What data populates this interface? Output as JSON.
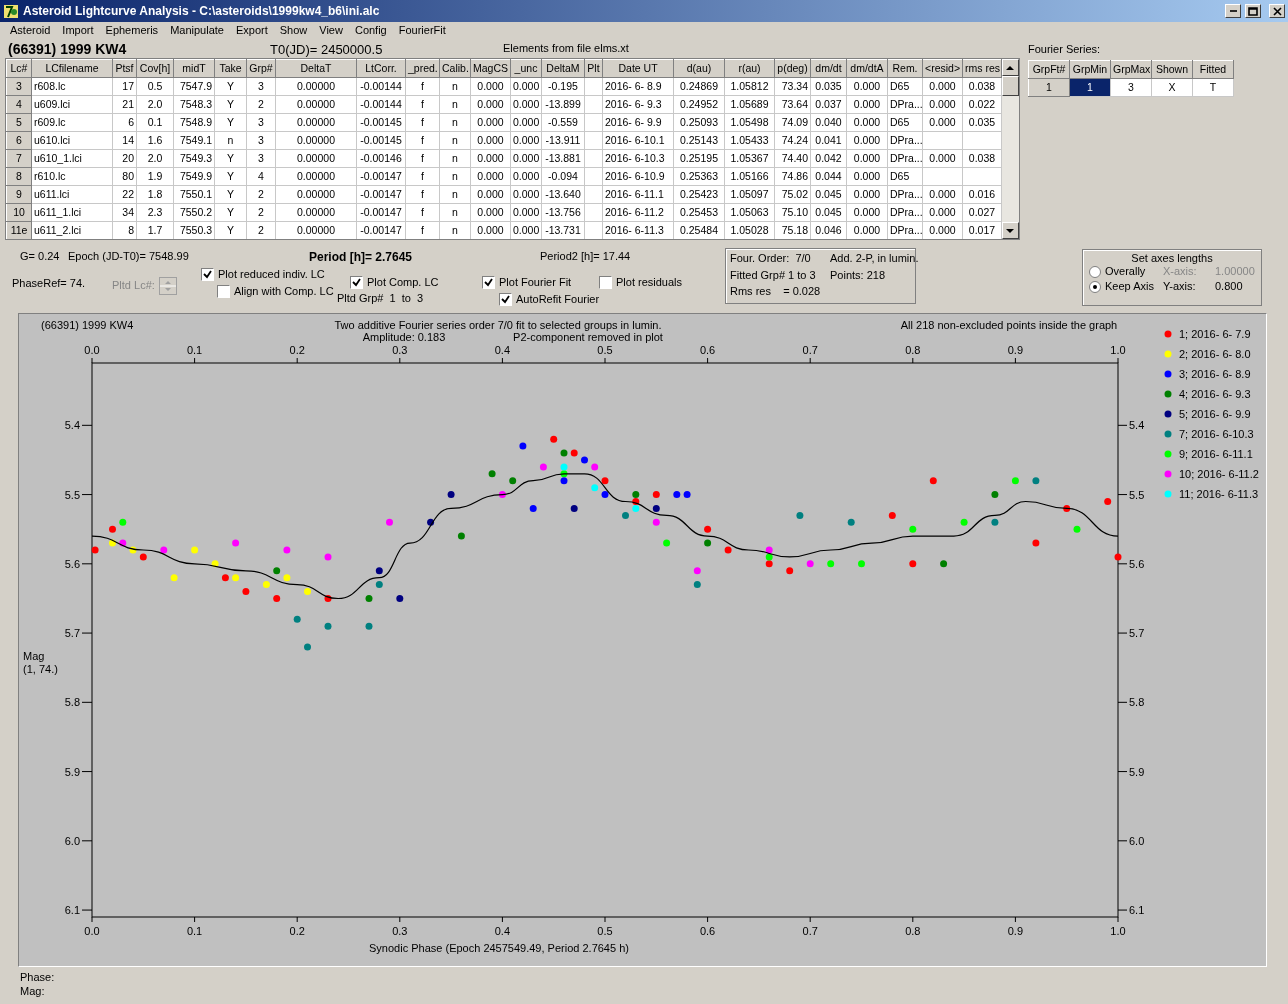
{
  "window": {
    "title": "Asteroid Lightcurve Analysis - C:\\asteroids\\1999kw4_b6\\ini.alc"
  },
  "menu": [
    "Asteroid",
    "Import",
    "Ephemeris",
    "Manipulate",
    "Export",
    "Show",
    "View",
    "Config",
    "FourierFit"
  ],
  "asteroid_name": "(66391) 1999 KW4",
  "t0": "T0(JD)= 2450000.5",
  "elements_note": "Elements from file elms.xt",
  "lc_table": {
    "columns": [
      "Lc#",
      "LCfilename",
      "Ptsf",
      "Cov[h]",
      "midT",
      "Take",
      "Grp#",
      "DeltaT",
      "LtCorr.",
      "_pred.",
      "Calib.",
      "MagCS",
      "_unc",
      "DeltaM",
      "Plt",
      "Date UT",
      "d(au)",
      "r(au)",
      "p(deg)",
      "dm/dt",
      "dm/dtA",
      "Rem.",
      "<resid>",
      "rms res"
    ],
    "rows": [
      {
        "cells": [
          "3",
          "r608.lc",
          "17",
          "0.5",
          "7547.9",
          "Y",
          "3",
          "0.00000",
          "-0.00144",
          "f",
          "n",
          "0.000",
          "0.000",
          "-0.195",
          null,
          "2016- 6- 8.9",
          "0.24869",
          "1.05812",
          "73.34",
          "0.035",
          "0.000",
          "D65",
          "0.000",
          "0.038"
        ]
      },
      {
        "cells": [
          "4",
          "u609.lci",
          "21",
          "2.0",
          "7548.3",
          "Y",
          "2",
          "0.00000",
          "-0.00144",
          "f",
          "n",
          "0.000",
          "0.000",
          "-13.899",
          null,
          "2016- 6- 9.3",
          "0.24952",
          "1.05689",
          "73.64",
          "0.037",
          "0.000",
          "DPra...",
          "0.000",
          "0.022"
        ]
      },
      {
        "cells": [
          "5",
          "r609.lc",
          "6",
          "0.1",
          "7548.9",
          "Y",
          "3",
          "0.00000",
          "-0.00145",
          "f",
          "n",
          "0.000",
          "0.000",
          "-0.559",
          null,
          "2016- 6- 9.9",
          "0.25093",
          "1.05498",
          "74.09",
          "0.040",
          "0.000",
          "D65",
          "0.000",
          "0.035"
        ]
      },
      {
        "cells": [
          "6",
          "u610.lci",
          "14",
          "1.6",
          "7549.1",
          "n",
          "3",
          "0.00000",
          "-0.00145",
          "f",
          "n",
          "0.000",
          "0.000",
          "-13.911",
          null,
          "2016- 6-10.1",
          "0.25143",
          "1.05433",
          "74.24",
          "0.041",
          "0.000",
          "DPra...",
          null,
          null
        ]
      },
      {
        "cells": [
          "7",
          "u610_1.lci",
          "20",
          "2.0",
          "7549.3",
          "Y",
          "3",
          "0.00000",
          "-0.00146",
          "f",
          "n",
          "0.000",
          "0.000",
          "-13.881",
          null,
          "2016- 6-10.3",
          "0.25195",
          "1.05367",
          "74.40",
          "0.042",
          "0.000",
          "DPra...",
          "0.000",
          "0.038"
        ]
      },
      {
        "cells": [
          "8",
          "r610.lc",
          "80",
          "1.9",
          "7549.9",
          "Y",
          "4",
          "0.00000",
          "-0.00147",
          "f",
          "n",
          "0.000",
          "0.000",
          "-0.094",
          null,
          "2016- 6-10.9",
          "0.25363",
          "1.05166",
          "74.86",
          "0.044",
          "0.000",
          "D65",
          null,
          null
        ]
      },
      {
        "cells": [
          "9",
          "u611.lci",
          "22",
          "1.8",
          "7550.1",
          "Y",
          "2",
          "0.00000",
          "-0.00147",
          "f",
          "n",
          "0.000",
          "0.000",
          "-13.640",
          null,
          "2016- 6-11.1",
          "0.25423",
          "1.05097",
          "75.02",
          "0.045",
          "0.000",
          "DPra...",
          "0.000",
          "0.016"
        ]
      },
      {
        "cells": [
          "10",
          "u611_1.lci",
          "34",
          "2.3",
          "7550.2",
          "Y",
          "2",
          "0.00000",
          "-0.00147",
          "f",
          "n",
          "0.000",
          "0.000",
          "-13.756",
          null,
          "2016- 6-11.2",
          "0.25453",
          "1.05063",
          "75.10",
          "0.045",
          "0.000",
          "DPra...",
          "0.000",
          "0.027"
        ]
      },
      {
        "cells": [
          "11e",
          "u611_2.lci",
          "8",
          "1.7",
          "7550.3",
          "Y",
          "2",
          "0.00000",
          "-0.00147",
          "f",
          "n",
          "0.000",
          "0.000",
          "-13.731",
          null,
          "2016- 6-11.3",
          "0.25484",
          "1.05028",
          "75.18",
          "0.046",
          "0.000",
          "DPra...",
          "0.000",
          "0.017"
        ]
      }
    ]
  },
  "fourier_series": {
    "label": "Fourier Series:",
    "columns": [
      "GrpFt#",
      "GrpMin",
      "GrpMax",
      "Shown",
      "Fitted"
    ],
    "rows": [
      {
        "cells": [
          {
            "text": "1",
            "selected": false
          },
          {
            "text": "1",
            "selected": true
          },
          {
            "text": "3",
            "selected": false
          },
          {
            "text": "X",
            "selected": false
          },
          {
            "text": "T",
            "selected": false
          }
        ]
      }
    ]
  },
  "params": {
    "g": "G= 0.24",
    "epoch": "Epoch (JD-T0)= 7548.99",
    "period": "Period [h]= 2.7645",
    "period2": "Period2 [h]= 17.44",
    "phase_ref": "PhaseRef= 74.",
    "pltd_lc": {
      "label": "Pltd Lc#:",
      "disabled": true
    },
    "pltd_grp": "Pltd Grp#  1  to  3"
  },
  "checkboxes": [
    {
      "label": "Plot reduced indiv. LC",
      "checked": true
    },
    {
      "label": "Align with Comp. LC",
      "checked": false
    },
    {
      "label": "Plot Comp. LC",
      "checked": true
    },
    {
      "label": "Plot Fourier Fit",
      "checked": true
    },
    {
      "label": "AutoRefit Fourier",
      "checked": true
    },
    {
      "label": "Plot residuals",
      "checked": false
    }
  ],
  "fit_info": [
    "Four. Order:  7/0",
    "Add. 2-P, in lumin.",
    "Fitted Grp# 1 to 3",
    "Points: 218",
    "Rms res    = 0.028"
  ],
  "axes_box": {
    "title": "Set axes lengths",
    "options": [
      {
        "label": "Overally",
        "selected": false
      },
      {
        "label": "Keep Axis",
        "selected": true
      }
    ],
    "x_axis": {
      "label": "X-axis:",
      "value": "1.00000",
      "disabled": true
    },
    "y_axis": {
      "label": "Y-axis:",
      "value": "0.800",
      "disabled": false
    }
  },
  "plot": {
    "object_name": "(66391) 1999 KW4",
    "title": "Two additive Fourier series order 7/0 fit to selected groups in lumin.",
    "amplitude": "Amplitude: 0.183",
    "note": "P2-component removed in plot",
    "points_note": "All 218 non-excluded points inside the graph",
    "ylabel_note": "(1, 74.)",
    "chart_data": {
      "type": "scatter",
      "xlabel": "Synodic Phase (Epoch 2457549.49, Period 2.7645 h)",
      "ylabel": "Mag",
      "xlim": [
        0,
        1
      ],
      "ylim": [
        6.11,
        5.31
      ],
      "xticks": [
        {
          "value": 0,
          "label": "0.0"
        },
        {
          "value": 0.1,
          "label": "0.1"
        },
        {
          "value": 0.2,
          "label": "0.2"
        },
        {
          "value": 0.3,
          "label": "0.3"
        },
        {
          "value": 0.4,
          "label": "0.4"
        },
        {
          "value": 0.5,
          "label": "0.5"
        },
        {
          "value": 0.6,
          "label": "0.6"
        },
        {
          "value": 0.7,
          "label": "0.7"
        },
        {
          "value": 0.8,
          "label": "0.8"
        },
        {
          "value": 0.9,
          "label": "0.9"
        },
        {
          "value": 1,
          "label": "1.0"
        }
      ],
      "yticks": [
        {
          "value": 5.4,
          "label": "5.4"
        },
        {
          "value": 5.5,
          "label": "5.5"
        },
        {
          "value": 5.6,
          "label": "5.6"
        },
        {
          "value": 5.7,
          "label": "5.7"
        },
        {
          "value": 5.8,
          "label": "5.8"
        },
        {
          "value": 5.9,
          "label": "5.9"
        },
        {
          "value": 6,
          "label": "6.0"
        },
        {
          "value": 6.1,
          "label": "6.1"
        }
      ],
      "series": [
        {
          "name": "1; 2016- 6- 7.9",
          "color": "#ff0000",
          "x": [
            0.003,
            0.02,
            0.05,
            0.13,
            0.15,
            0.18,
            0.23,
            0.45,
            0.47,
            0.5,
            0.53,
            0.55,
            0.6,
            0.62,
            0.66,
            0.68,
            0.78,
            0.8,
            0.82,
            0.92,
            0.95,
            0.99,
            1.0
          ],
          "values": [
            5.58,
            5.55,
            5.59,
            5.62,
            5.64,
            5.65,
            5.65,
            5.42,
            5.44,
            5.48,
            5.51,
            5.5,
            5.55,
            5.58,
            5.6,
            5.61,
            5.53,
            5.6,
            5.48,
            5.57,
            5.52,
            5.51,
            5.59
          ]
        },
        {
          "name": "2; 2016- 6- 8.0",
          "color": "#ffff00",
          "x": [
            0.02,
            0.04,
            0.08,
            0.1,
            0.12,
            0.14,
            0.17,
            0.19,
            0.21
          ],
          "values": [
            5.57,
            5.58,
            5.62,
            5.58,
            5.6,
            5.62,
            5.63,
            5.62,
            5.64
          ]
        },
        {
          "name": "3; 2016- 6- 8.9",
          "color": "#0000ff",
          "x": [
            0.42,
            0.43,
            0.46,
            0.48,
            0.5,
            0.57,
            0.58
          ],
          "values": [
            5.43,
            5.52,
            5.48,
            5.45,
            5.5,
            5.5,
            5.5
          ]
        },
        {
          "name": "4; 2016- 6- 9.3",
          "color": "#008000",
          "x": [
            0.18,
            0.27,
            0.36,
            0.39,
            0.41,
            0.46,
            0.53,
            0.6,
            0.83,
            0.88
          ],
          "values": [
            5.61,
            5.65,
            5.56,
            5.47,
            5.48,
            5.44,
            5.5,
            5.57,
            5.6,
            5.5
          ]
        },
        {
          "name": "5; 2016- 6- 9.9",
          "color": "#000080",
          "x": [
            0.28,
            0.3,
            0.33,
            0.35,
            0.47,
            0.55
          ],
          "values": [
            5.61,
            5.65,
            5.54,
            5.5,
            5.52,
            5.52
          ]
        },
        {
          "name": "7; 2016- 6-10.3",
          "color": "#008080",
          "x": [
            0.2,
            0.21,
            0.23,
            0.27,
            0.28,
            0.52,
            0.59,
            0.69,
            0.74,
            0.88,
            0.92
          ],
          "values": [
            5.68,
            5.72,
            5.69,
            5.69,
            5.63,
            5.53,
            5.63,
            5.53,
            5.54,
            5.54,
            5.48
          ]
        },
        {
          "name": "9; 2016- 6-11.1",
          "color": "#00ff00",
          "x": [
            0.03,
            0.46,
            0.56,
            0.66,
            0.72,
            0.75,
            0.8,
            0.85,
            0.9,
            0.96
          ],
          "values": [
            5.54,
            5.47,
            5.57,
            5.59,
            5.6,
            5.6,
            5.55,
            5.54,
            5.48,
            5.55
          ]
        },
        {
          "name": "10; 2016- 6-11.2",
          "color": "#ff00ff",
          "x": [
            0.03,
            0.07,
            0.14,
            0.19,
            0.23,
            0.29,
            0.4,
            0.44,
            0.49,
            0.55,
            0.59,
            0.66,
            0.7
          ],
          "values": [
            5.57,
            5.58,
            5.57,
            5.58,
            5.59,
            5.54,
            5.5,
            5.46,
            5.46,
            5.54,
            5.61,
            5.58,
            5.6
          ]
        },
        {
          "name": "11; 2016- 6-11.3",
          "color": "#00ffff",
          "x": [
            0.46,
            0.49,
            0.53
          ],
          "values": [
            5.46,
            5.49,
            5.52
          ]
        },
        {
          "type": "line",
          "color": "#000000",
          "x": [
            0,
            0.05,
            0.1,
            0.15,
            0.2,
            0.24,
            0.28,
            0.31,
            0.35,
            0.4,
            0.43,
            0.46,
            0.48,
            0.52,
            0.56,
            0.6,
            0.64,
            0.68,
            0.72,
            0.76,
            0.8,
            0.84,
            0.88,
            0.91,
            0.95,
            1.0
          ],
          "values": [
            5.56,
            5.58,
            5.6,
            5.61,
            5.63,
            5.65,
            5.62,
            5.57,
            5.52,
            5.5,
            5.48,
            5.47,
            5.47,
            5.51,
            5.53,
            5.56,
            5.58,
            5.59,
            5.58,
            5.57,
            5.56,
            5.56,
            5.53,
            5.51,
            5.52,
            5.56
          ]
        }
      ],
      "legend": true
    },
    "top_tick_labels": [
      "0.0",
      "0.1",
      "0.2",
      "0.3",
      "0.4",
      "0.5",
      "0.6",
      "0.7",
      "0.8",
      "0.9",
      "1.0"
    ],
    "right_tick_labels": [
      "5.4",
      "5.5",
      "5.6",
      "5.7",
      "5.8",
      "5.9",
      "6.0",
      "6.1"
    ]
  },
  "status": {
    "phase": "Phase:",
    "mag": "Mag:"
  }
}
